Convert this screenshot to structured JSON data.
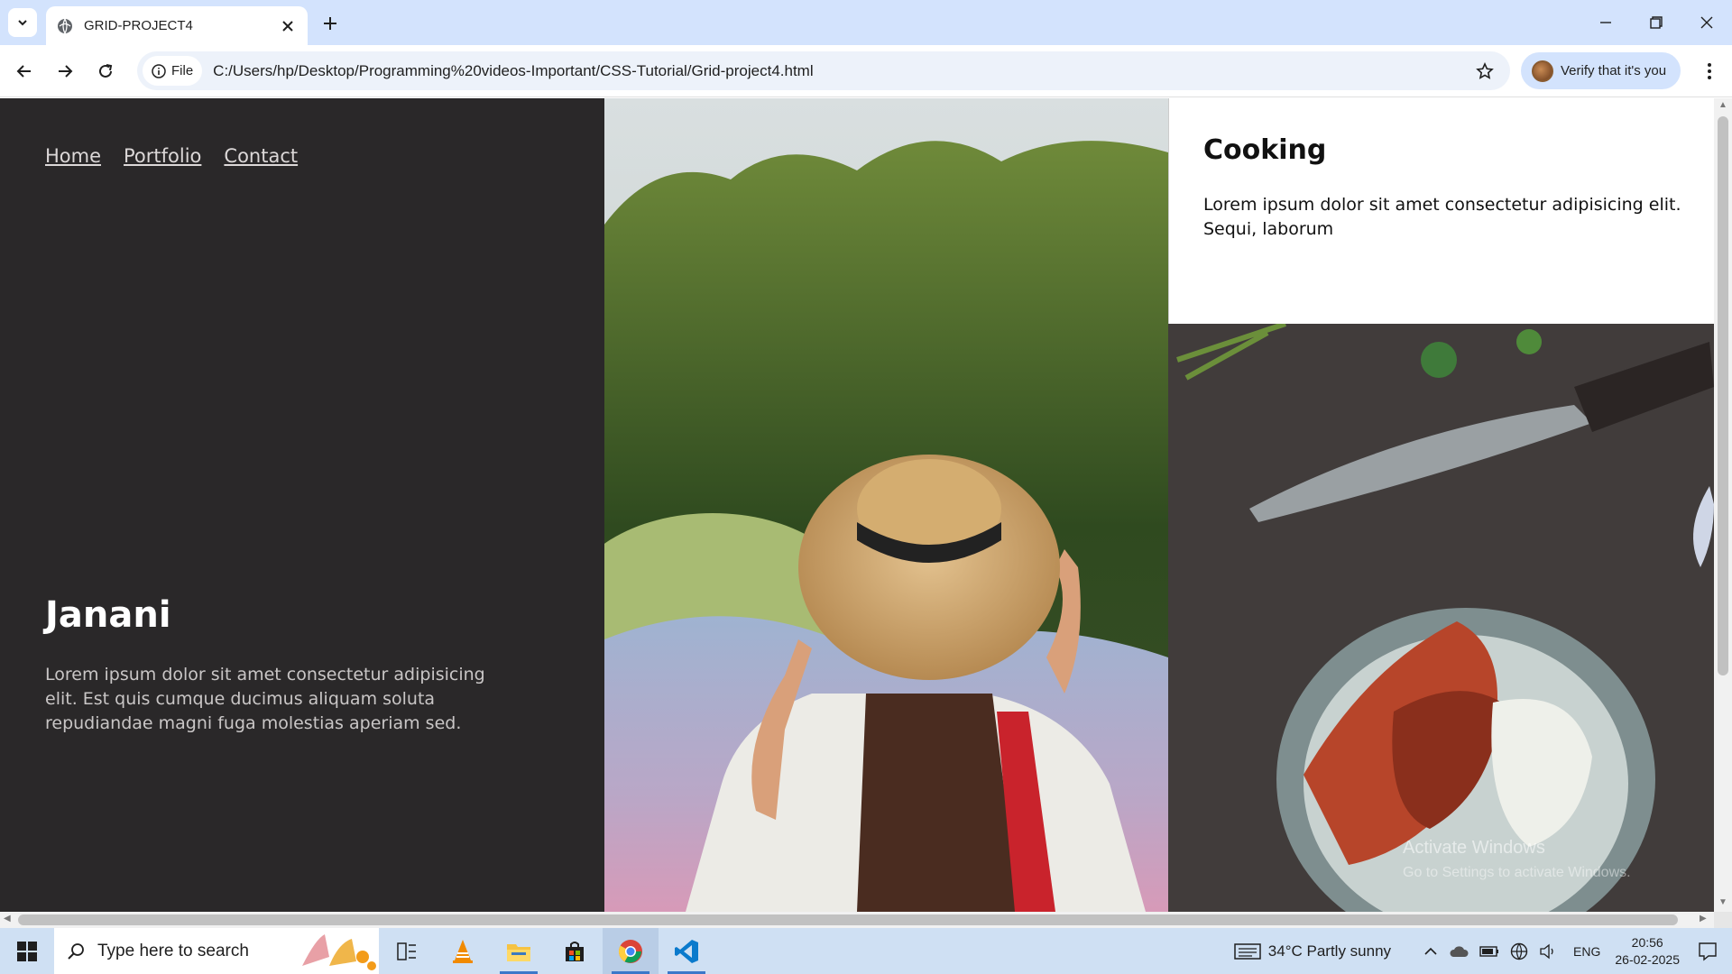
{
  "browser": {
    "tab_title": "GRID-PROJECT4",
    "url_chip": "File",
    "url": "C:/Users/hp/Desktop/Programming%20videos-Important/CSS-Tutorial/Grid-project4.html",
    "verify_label": "Verify that it's you"
  },
  "page": {
    "nav": [
      "Home",
      "Portfolio",
      "Contact"
    ],
    "hero": {
      "name": "Janani",
      "text": "Lorem ipsum dolor sit amet consectetur adipisicing elit. Est quis cumque ducimus aliquam soluta repudiandae magni fuga molestias aperiam sed."
    },
    "card": {
      "title": "Cooking",
      "text": "Lorem ipsum dolor sit amet consectetur adipisicing elit. Sequi, laborum"
    },
    "watermark": {
      "line1": "Activate Windows",
      "line2": "Go to Settings to activate Windows."
    }
  },
  "taskbar": {
    "search_placeholder": "Type here to search",
    "weather": "34°C  Partly sunny",
    "lang": "ENG",
    "time": "20:56",
    "date": "26-02-2025"
  }
}
